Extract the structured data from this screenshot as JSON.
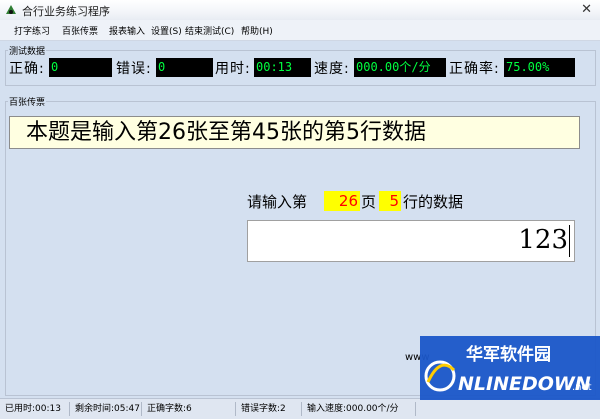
{
  "window": {
    "title": "合行业务练习程序",
    "close_glyph": "✕"
  },
  "menu": [
    "打字练习",
    "百张传票",
    "报表输入",
    "设置(S)",
    "结束测试(C)",
    "帮助(H)"
  ],
  "test_group": {
    "label": "测试数据",
    "correct_label": "正确:",
    "correct_value": "0",
    "error_label": "错误:",
    "error_value": "0",
    "time_label": "用时:",
    "time_value": "00:13",
    "speed_label": "速度:",
    "speed_value": "000.00个/分",
    "accuracy_label": "正确率:",
    "accuracy_value": "75.00%"
  },
  "main_group": {
    "label": "百张传票",
    "question": "本题是输入第26张至第45张的第5行数据",
    "prompt_prefix": "请输入第",
    "page_value": "26",
    "page_unit": "页",
    "row_value": "5",
    "row_suffix": "行的数据",
    "answer_value": "123"
  },
  "url_stub": "www",
  "status": [
    "已用时:00:13",
    "剩余时间:05:47",
    "正确字数:6",
    "错误字数:2",
    "输入速度:000.00个/分"
  ],
  "watermark": {
    "line1": "华军软件园",
    "line2": "ONLINEDOWN",
    "suffix": ".net"
  },
  "colors": {
    "window_bg": "#d4e0f0",
    "stat_bg": "#000000",
    "stat_text": "#00ff40",
    "question_bg": "#ffffe1",
    "highlight_bg": "#ffff00",
    "highlight_text": "#ff0000",
    "watermark_blue": "#1a56c8"
  }
}
